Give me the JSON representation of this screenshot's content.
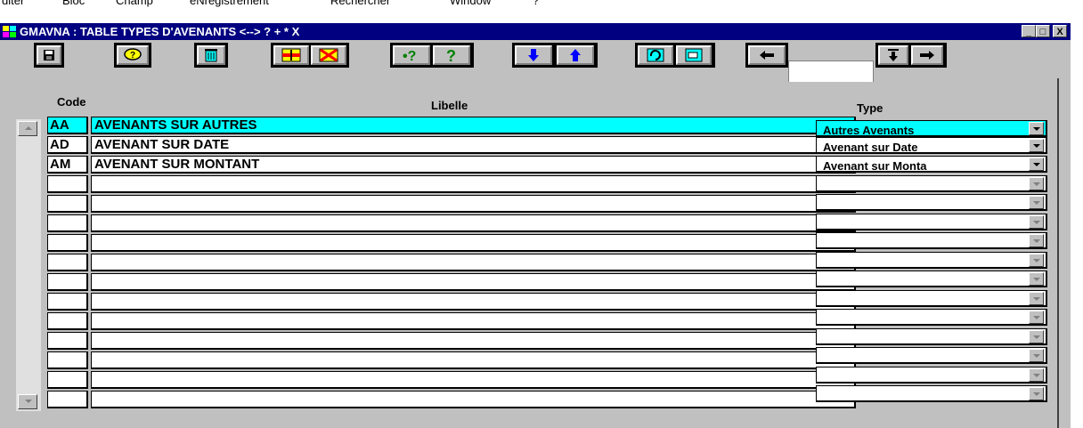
{
  "menu": [
    "diter",
    "Bloc",
    "Champ",
    "eNregistrement",
    "Rechercher",
    "Window",
    "?"
  ],
  "window": {
    "title": "GMAVNA : TABLE TYPES D'AVENANTS <--> ? + * X",
    "minimize": "_",
    "maximize": "□",
    "close": "X"
  },
  "colors": {
    "titlebar": "#000080",
    "selected": "#00ffff",
    "face": "#c0c0c0"
  },
  "toolbar": {
    "buttons": [
      "save-icon",
      "query-icon",
      "delete-icon",
      "insert-record-icon",
      "remove-record-icon",
      "enter-query-icon",
      "execute-query-icon",
      "next-icon",
      "previous-icon",
      "refresh-icon",
      "print-icon",
      "left-arrow-icon",
      "record-down-icon",
      "right-arrow-icon"
    ],
    "record_input": ""
  },
  "table": {
    "headers": {
      "code": "Code",
      "libelle": "Libelle",
      "type": "Type"
    },
    "rows": [
      {
        "code": "AA",
        "libelle": "AVENANTS SUR AUTRES",
        "type": "Autres Avenants"
      },
      {
        "code": "AD",
        "libelle": "AVENANT SUR DATE",
        "type": "Avenant sur Date"
      },
      {
        "code": "AM",
        "libelle": "AVENANT SUR MONTANT",
        "type": "Avenant sur Monta"
      },
      {
        "code": "",
        "libelle": "",
        "type": ""
      },
      {
        "code": "",
        "libelle": "",
        "type": ""
      },
      {
        "code": "",
        "libelle": "",
        "type": ""
      },
      {
        "code": "",
        "libelle": "",
        "type": ""
      },
      {
        "code": "",
        "libelle": "",
        "type": ""
      },
      {
        "code": "",
        "libelle": "",
        "type": ""
      },
      {
        "code": "",
        "libelle": "",
        "type": ""
      },
      {
        "code": "",
        "libelle": "",
        "type": ""
      },
      {
        "code": "",
        "libelle": "",
        "type": ""
      },
      {
        "code": "",
        "libelle": "",
        "type": ""
      },
      {
        "code": "",
        "libelle": "",
        "type": ""
      },
      {
        "code": "",
        "libelle": "",
        "type": ""
      }
    ]
  }
}
